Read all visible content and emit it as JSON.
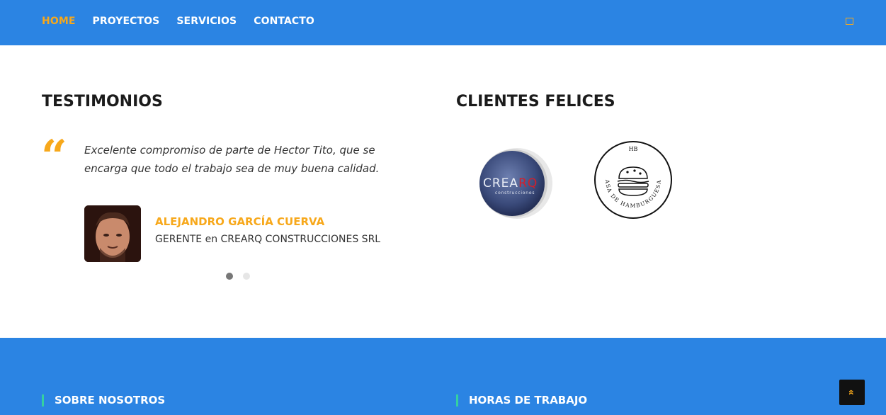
{
  "nav": {
    "items": [
      {
        "label": "HOME",
        "active": true
      },
      {
        "label": "PROYECTOS"
      },
      {
        "label": "SERVICIOS"
      },
      {
        "label": "CONTACTO"
      }
    ]
  },
  "testimonios": {
    "title": "TESTIMONIOS",
    "quote_icon": "quote-open-icon",
    "quote": "Excelente compromiso de parte de Hector Tito, que se encarga que todo el trabajo sea de muy buena calidad.",
    "author_name": "ALEJANDRO GARCÍA CUERVA",
    "author_role": "GERENTE en CREARQ CONSTRUCCIONES SRL",
    "slides_total": 2,
    "active_slide": 1
  },
  "clientes": {
    "title": "CLIENTES FELICES",
    "logos": [
      {
        "name": "CREARQ",
        "crea": "CREA",
        "rq": "RQ",
        "sub": "construcciones"
      },
      {
        "name": "HB",
        "initials": "HB",
        "ring_text": "CASA DE HAMBURGUESAS"
      }
    ]
  },
  "footer": {
    "col1_title": "SOBRE NOSOTROS",
    "col2_title": "HORAS DE TRABAJO"
  },
  "back_to_top_icon": "double-chevron-up-icon",
  "colors": {
    "primary": "#2b84e3",
    "accent": "#f7a81b",
    "footer_marker": "#35d0a0"
  }
}
